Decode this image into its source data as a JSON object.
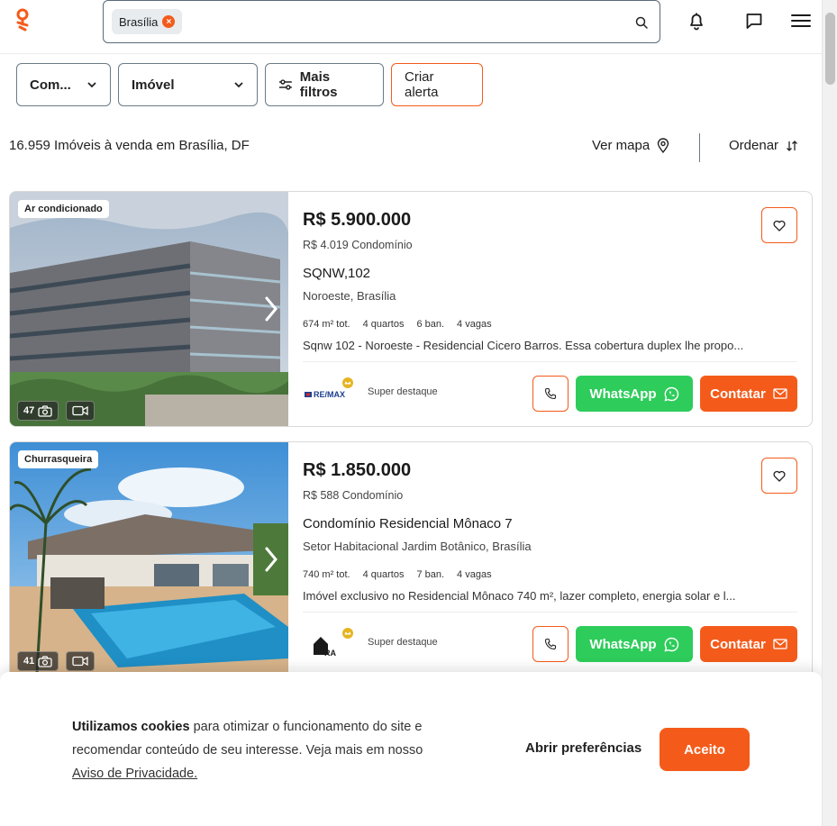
{
  "search": {
    "chip_label": "Brasília"
  },
  "filters": {
    "transaction": "Com...",
    "type": "Imóvel",
    "more": "Mais filtros",
    "alert": "Criar alerta"
  },
  "results": {
    "count_text": "16.959 Imóveis à venda em Brasília, DF",
    "map_label": "Ver mapa",
    "sort_label": "Ordenar"
  },
  "listings": [
    {
      "badge": "Ar condicionado",
      "price": "R$ 5.900.000",
      "condo": "R$ 4.019 Condomínio",
      "title": "SQNW,102",
      "address": "Noroeste, Brasília",
      "area": "674 m² tot.",
      "rooms": "4 quartos",
      "baths": "6 ban.",
      "parking": "4 vagas",
      "description": "Sqnw 102 - Noroeste - Residencial Cicero Barros. Essa cobertura duplex lhe propo...",
      "photos": "47",
      "highlight": "Super destaque",
      "advertiser_logo_text": "RE/MAX",
      "whatsapp": "WhatsApp",
      "contact": "Contatar"
    },
    {
      "badge": "Churrasqueira",
      "price": "R$ 1.850.000",
      "condo": "R$ 588 Condomínio",
      "title": "Condomínio Residencial Mônaco 7",
      "address": "Setor Habitacional Jardim Botânico, Brasília",
      "area": "740 m² tot.",
      "rooms": "4 quartos",
      "baths": "7 ban.",
      "parking": "4 vagas",
      "description": "Imóvel exclusivo no Residencial Mônaco 740 m², lazer completo, energia solar e l...",
      "photos": "41",
      "highlight": "Super destaque",
      "advertiser_logo_text": "RA",
      "whatsapp": "WhatsApp",
      "contact": "Contatar"
    }
  ],
  "cookie": {
    "bold": "Utilizamos cookies",
    "text": " para otimizar o funcionamento do site e recomendar conteúdo de seu interesse. Veja mais em nosso ",
    "link": "Aviso de Privacidade.",
    "preferences": "Abrir preferências",
    "accept": "Aceito"
  },
  "colors": {
    "brand": "#f45b1b",
    "whatsapp": "#2ecc5b"
  }
}
